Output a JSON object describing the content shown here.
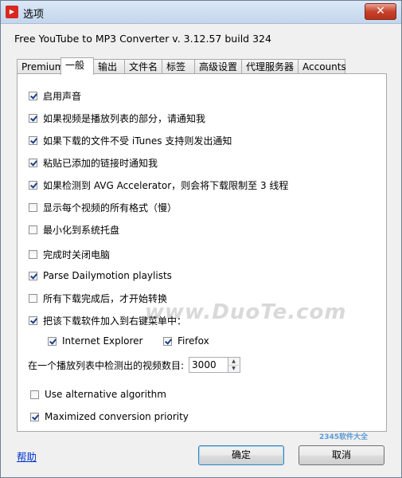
{
  "window": {
    "title": "选项",
    "close_glyph": "✕",
    "icon": "app-logo-icon"
  },
  "app_version": "Free YouTube to MP3 Converter  v. 3.12.57 build 324",
  "tabs": [
    {
      "label": "Premium",
      "active": false
    },
    {
      "label": "一般",
      "active": true
    },
    {
      "label": "输出",
      "active": false
    },
    {
      "label": "文件名",
      "active": false
    },
    {
      "label": "标签",
      "active": false
    },
    {
      "label": "高级设置",
      "active": false
    },
    {
      "label": "代理服务器",
      "active": false
    },
    {
      "label": "Accounts",
      "active": false
    }
  ],
  "options": [
    {
      "label": "启用声音",
      "checked": true
    },
    {
      "label": "如果视频是播放列表的部分，请通知我",
      "checked": true
    },
    {
      "label": "如果下载的文件不受 iTunes 支持则发出通知",
      "checked": true
    },
    {
      "label": "粘贴已添加的链接时通知我",
      "checked": true
    },
    {
      "label": "如果检测到 AVG Accelerator，则会将下载限制至 3 线程",
      "checked": true
    },
    {
      "label": "显示每个视频的所有格式（慢）",
      "checked": false
    },
    {
      "label": "最小化到系统托盘",
      "checked": false
    },
    {
      "label": "完成时关闭电脑",
      "checked": false
    },
    {
      "label": "Parse Dailymotion playlists",
      "checked": true
    },
    {
      "label": "所有下载完成后，才开始转换",
      "checked": false
    },
    {
      "label": "把该下载软件加入到右键菜单中：",
      "checked": true
    }
  ],
  "browsers": [
    {
      "label": "Internet Explorer",
      "checked": true
    },
    {
      "label": "Firefox",
      "checked": true
    }
  ],
  "playlist_count": {
    "label": "在一个播放列表中检测出的视频数目:",
    "value": "3000"
  },
  "advanced": [
    {
      "label": "Use alternative algorithm",
      "checked": false
    },
    {
      "label": "Maximized conversion priority",
      "checked": true
    }
  ],
  "footer": {
    "help": "帮助",
    "ok": "确定",
    "cancel": "取消"
  },
  "watermark": "www.DuoTe.com",
  "watermark2": "2345软件大全"
}
